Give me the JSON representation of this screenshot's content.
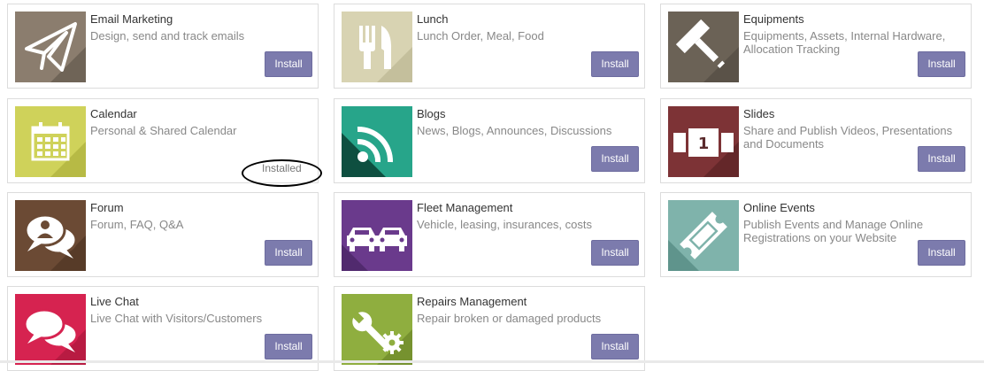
{
  "apps": [
    {
      "name": "Email Marketing",
      "summary": "Design, send and track emails",
      "button": "Install",
      "icon": "paper-plane-icon",
      "color": "#8b7d6e"
    },
    {
      "name": "Lunch",
      "summary": "Lunch Order, Meal, Food",
      "button": "Install",
      "icon": "fork-knife-icon",
      "color": "#d8d3b2"
    },
    {
      "name": "Equipments",
      "summary": "Equipments, Assets, Internal Hardware, Allocation Tracking",
      "button": "Install",
      "icon": "hammer-icon",
      "color": "#6b6256"
    },
    {
      "name": "Calendar",
      "summary": "Personal & Shared Calendar",
      "status": "Installed",
      "icon": "calendar-icon",
      "color": "#cfd25a"
    },
    {
      "name": "Blogs",
      "summary": "News, Blogs, Announces, Discussions",
      "button": "Install",
      "icon": "rss-icon",
      "color": "#27a58a"
    },
    {
      "name": "Slides",
      "summary": "Share and Publish Videos, Presentations and Documents",
      "button": "Install",
      "icon": "slides-icon",
      "color": "#7d3336",
      "slide_number": "1"
    },
    {
      "name": "Forum",
      "summary": "Forum, FAQ, Q&A",
      "button": "Install",
      "icon": "chat-bubbles-user-icon",
      "color": "#6b4a34"
    },
    {
      "name": "Fleet Management",
      "summary": "Vehicle, leasing, insurances, costs",
      "button": "Install",
      "icon": "cars-icon",
      "color": "#6a3a8c"
    },
    {
      "name": "Online Events",
      "summary": "Publish Events and Manage Online Registrations on your Website",
      "button": "Install",
      "icon": "ticket-icon",
      "color": "#7fb3ab"
    },
    {
      "name": "Live Chat",
      "summary": "Live Chat with Visitors/Customers",
      "button": "Install",
      "icon": "chat-bubbles-icon",
      "color": "#d62350"
    },
    {
      "name": "Repairs Management",
      "summary": "Repair broken or damaged products",
      "button": "Install",
      "icon": "wrench-gear-icon",
      "color": "#8fae3f"
    }
  ]
}
